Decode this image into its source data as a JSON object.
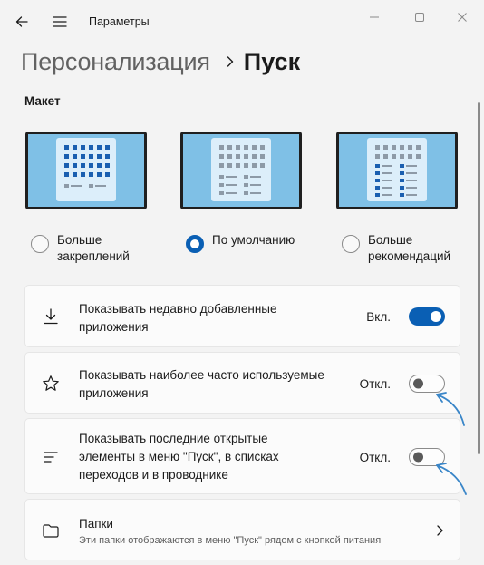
{
  "window": {
    "title": "Параметры",
    "controls": [
      "minimize-icon",
      "maximize-icon",
      "close-icon"
    ]
  },
  "breadcrumb": {
    "parent": "Персонализация",
    "current": "Пуск"
  },
  "layout": {
    "label": "Макет",
    "options": [
      {
        "label": "Больше закреплений",
        "selected": false
      },
      {
        "label": "По умолчанию",
        "selected": true
      },
      {
        "label": "Больше рекомендаций",
        "selected": false
      }
    ]
  },
  "settings": [
    {
      "icon": "download-icon",
      "text": "Показывать недавно добавленные приложения",
      "state_label": "Вкл.",
      "on": true
    },
    {
      "icon": "star-icon",
      "text": "Показывать наиболее часто используемые приложения",
      "state_label": "Откл.",
      "on": false
    },
    {
      "icon": "list-icon",
      "text": "Показывать последние открытые элементы в меню \"Пуск\", в списках переходов и в проводнике",
      "state_label": "Откл.",
      "on": false
    }
  ],
  "folders": {
    "icon": "folder-icon",
    "title": "Папки",
    "description": "Эти папки отображаются в меню \"Пуск\" рядом с кнопкой питания"
  },
  "colors": {
    "accent": "#0a5fb4",
    "annotation_arrow": "#3a86c8",
    "thumb_frame": "#1f1f1f",
    "thumb_wallpaper": "#7fc0e6",
    "thumb_panel": "#dceefa",
    "tile_blue": "#1a5fb0",
    "tile_gray": "#8d9aa7"
  }
}
